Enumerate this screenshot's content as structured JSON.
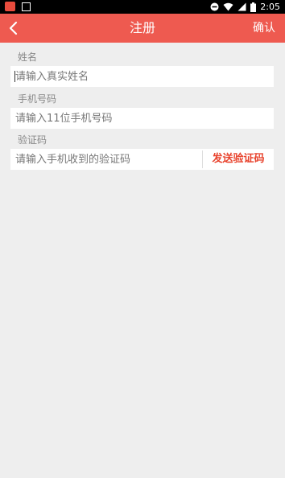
{
  "status_bar": {
    "time": "2:05",
    "icons": [
      "app-notification-icon",
      "sim-icon",
      "do-not-disturb-icon",
      "wifi-icon",
      "signal-icon",
      "battery-icon"
    ]
  },
  "nav": {
    "back_icon": "chevron-left-icon",
    "title": "注册",
    "confirm_label": "确认"
  },
  "form": {
    "name": {
      "label": "姓名",
      "placeholder": "请输入真实姓名",
      "value": ""
    },
    "phone": {
      "label": "手机号码",
      "placeholder": "请输入11位手机号码",
      "value": ""
    },
    "code": {
      "label": "验证码",
      "placeholder": "请输入手机收到的验证码",
      "value": "",
      "send_button_label": "发送验证码"
    }
  },
  "colors": {
    "accent": "#ee5a50",
    "send_button_text": "#e8432d",
    "background": "#eeeeee"
  }
}
